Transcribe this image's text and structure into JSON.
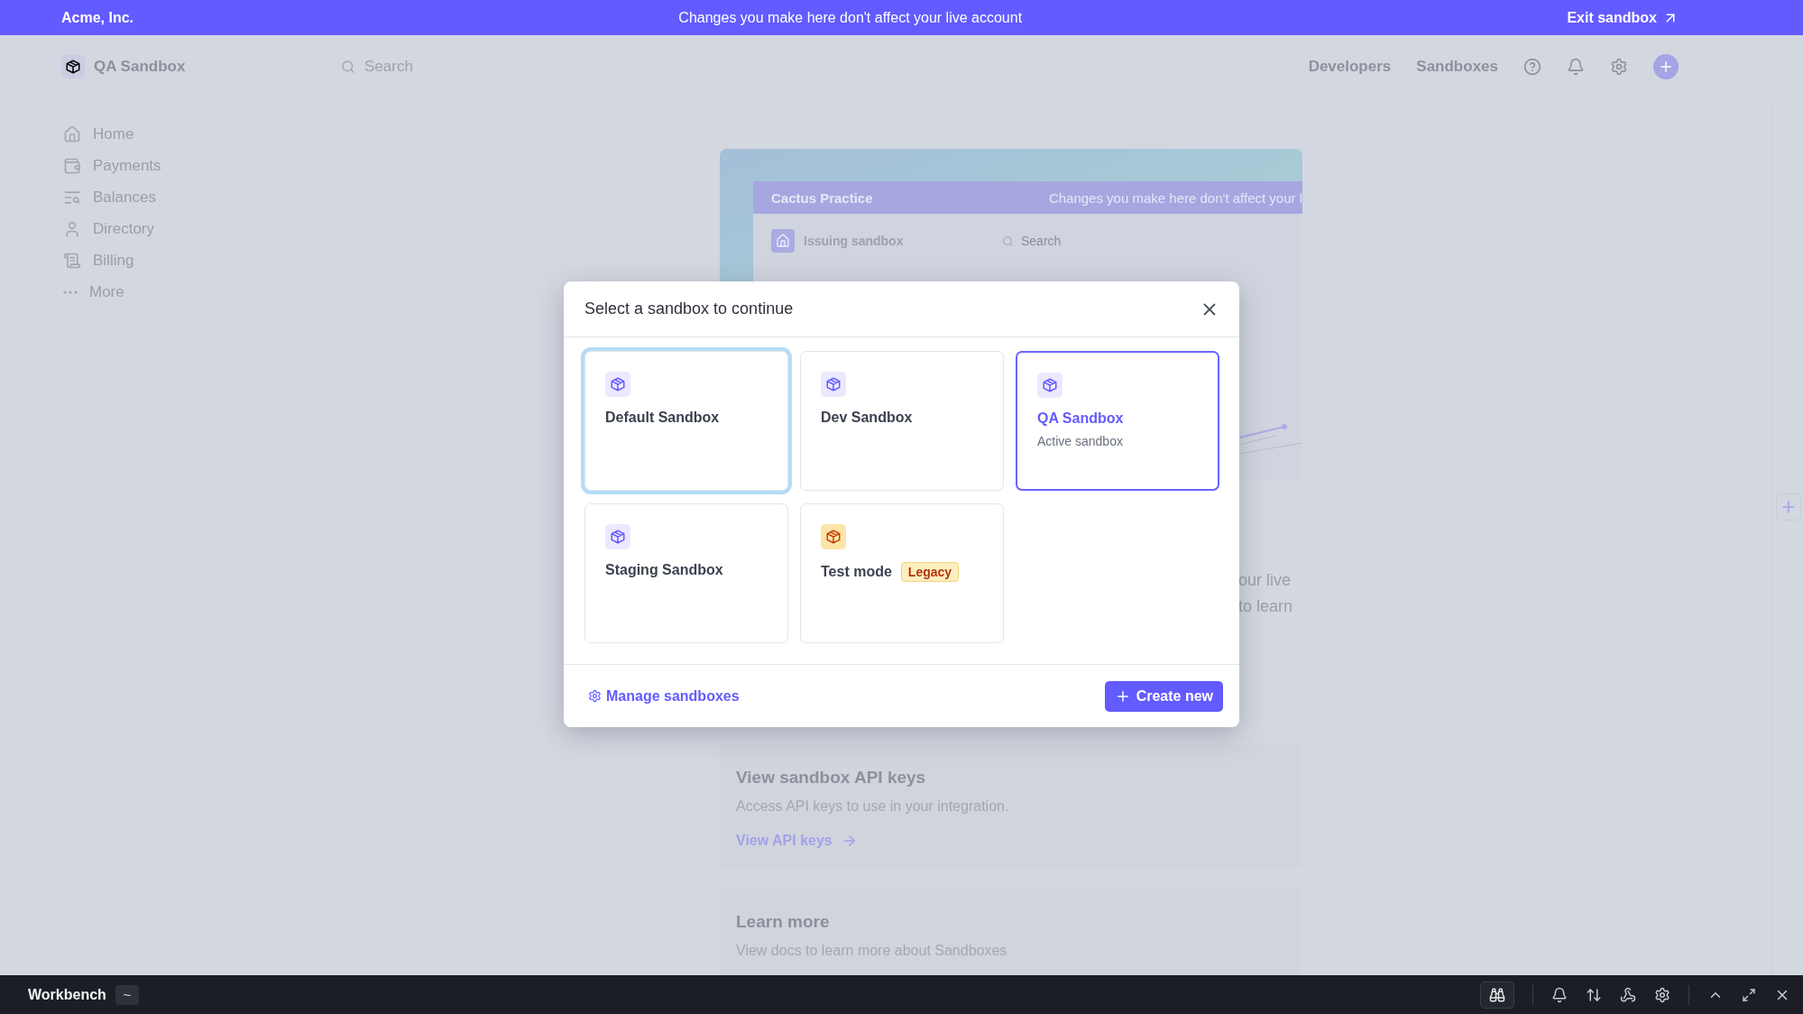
{
  "banner": {
    "account": "Acme, Inc.",
    "message": "Changes you make here don't affect your live account",
    "exit_link": "Exit sandbox"
  },
  "header": {
    "workspace": "QA Sandbox",
    "search": {
      "placeholder": "Search"
    },
    "nav": [
      "Developers",
      "Sandboxes"
    ]
  },
  "sidebar": {
    "items": [
      {
        "label": "Home"
      },
      {
        "label": "Payments"
      },
      {
        "label": "Balances"
      },
      {
        "label": "Directory"
      },
      {
        "label": "Billing"
      },
      {
        "label": "More"
      }
    ]
  },
  "hero": {
    "preview_account": "Cactus Practice",
    "preview_banner": "Changes you make here don't affect your l",
    "preview_workspace": "Issuing sandbox",
    "preview_search": {
      "placeholder": "Search"
    },
    "text_lines": [
      "our live",
      "to learn"
    ]
  },
  "cards": [
    {
      "title": "View sandbox API keys",
      "description": "Access API keys to use in your integration.",
      "link": "View API keys"
    },
    {
      "title": "Learn more",
      "description": "View docs to learn more about Sandboxes"
    }
  ],
  "modal": {
    "title": "Select a sandbox to continue",
    "sandboxes": [
      {
        "kind": "sandbox",
        "name": "Default Sandbox",
        "focused": true,
        "selected": false
      },
      {
        "kind": "sandbox",
        "name": "Dev Sandbox",
        "focused": false,
        "selected": false
      },
      {
        "kind": "sandbox",
        "name": "QA Sandbox",
        "note": "Active sandbox",
        "focused": false,
        "selected": true
      },
      {
        "kind": "sandbox",
        "name": "Staging Sandbox",
        "focused": false,
        "selected": false
      },
      {
        "kind": "test_mode",
        "name": "Test mode",
        "badge": "Legacy",
        "focused": false,
        "selected": false
      }
    ],
    "manage_link": "Manage sandboxes",
    "create_button": "Create new"
  },
  "workbench": {
    "title": "Workbench",
    "toggle": "~"
  }
}
